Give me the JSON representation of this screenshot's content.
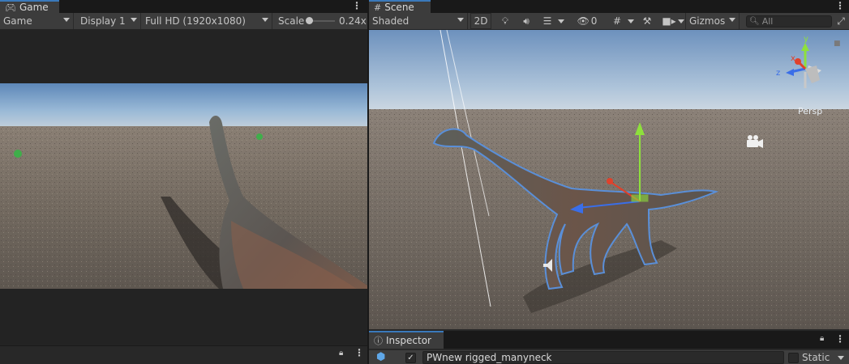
{
  "game": {
    "tab_label": "Game",
    "mode": "Game",
    "display": "Display 1",
    "resolution": "Full HD (1920x1080)",
    "scale_label": "Scale",
    "scale_value": "0.24x",
    "scale_level": 0.05
  },
  "scene": {
    "tab_label": "Scene",
    "draw_mode": "Shaded",
    "mode_2d": "2D",
    "hidden_count": "0",
    "gizmos_label": "Gizmos",
    "search_placeholder": "All",
    "gizmo_axes": {
      "y": "y",
      "x": "x",
      "z": "z"
    },
    "projection": "Persp"
  },
  "inspector": {
    "tab_label": "Inspector",
    "object_name": "PWnew rigged_manyneck",
    "static_label": "Static",
    "active": true
  },
  "colors": {
    "accent": "#3a79bb",
    "panel_bg": "#282828",
    "toolbar_bg": "#3c3c3c",
    "axis_y": "#8ee03c",
    "axis_x": "#e0412b",
    "axis_z": "#3a6ee8",
    "selection_outline": "#5a8fd8"
  }
}
